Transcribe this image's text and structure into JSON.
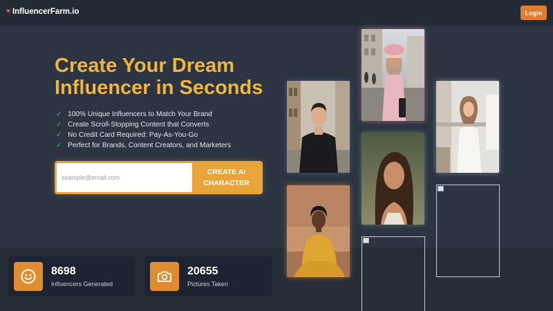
{
  "brand": {
    "name": "InfluencerFarm.io"
  },
  "header": {
    "login_label": "Login"
  },
  "hero": {
    "title_line1": "Create Your Dream",
    "title_line2": "Influencer in Seconds",
    "features": [
      "100% Unique Influencers to Match Your Brand",
      "Create Scroll-Stopping Content that Converts",
      "No Credit Card Required: Pay-As-You-Go",
      "Perfect for Brands, Content Creators, and Marketers"
    ]
  },
  "signup": {
    "email_placeholder": "example@email.com",
    "cta_line1": "CREATE AI",
    "cta_line2": "CHARACTER"
  },
  "stats": [
    {
      "value": "8698",
      "label": "Influencers Generated",
      "icon": "smiley-face-icon"
    },
    {
      "value": "20655",
      "label": "Pictures Taken",
      "icon": "camera-icon"
    }
  ],
  "gallery": [
    {
      "name": "woman-pink-beret-photo",
      "kind": "photo",
      "subject": "woman in pink beret and coat on city street"
    },
    {
      "name": "man-black-coat-photo",
      "kind": "photo",
      "subject": "man in black coat on street"
    },
    {
      "name": "woman-white-dress-photo",
      "kind": "photo",
      "subject": "woman in white dress in kitchen"
    },
    {
      "name": "woman-curly-hair-photo",
      "kind": "photo",
      "subject": "woman with long curly hair outdoors"
    },
    {
      "name": "woman-yellow-dress-photo",
      "kind": "photo",
      "subject": "woman in yellow dress sitting"
    },
    {
      "name": "broken-image-1",
      "kind": "broken"
    },
    {
      "name": "broken-image-2",
      "kind": "broken"
    }
  ],
  "colors": {
    "accent": "#e9a43c",
    "title": "#efb53f",
    "login": "#e07b2f",
    "background": "#2c3442",
    "check": "#43b96a"
  }
}
